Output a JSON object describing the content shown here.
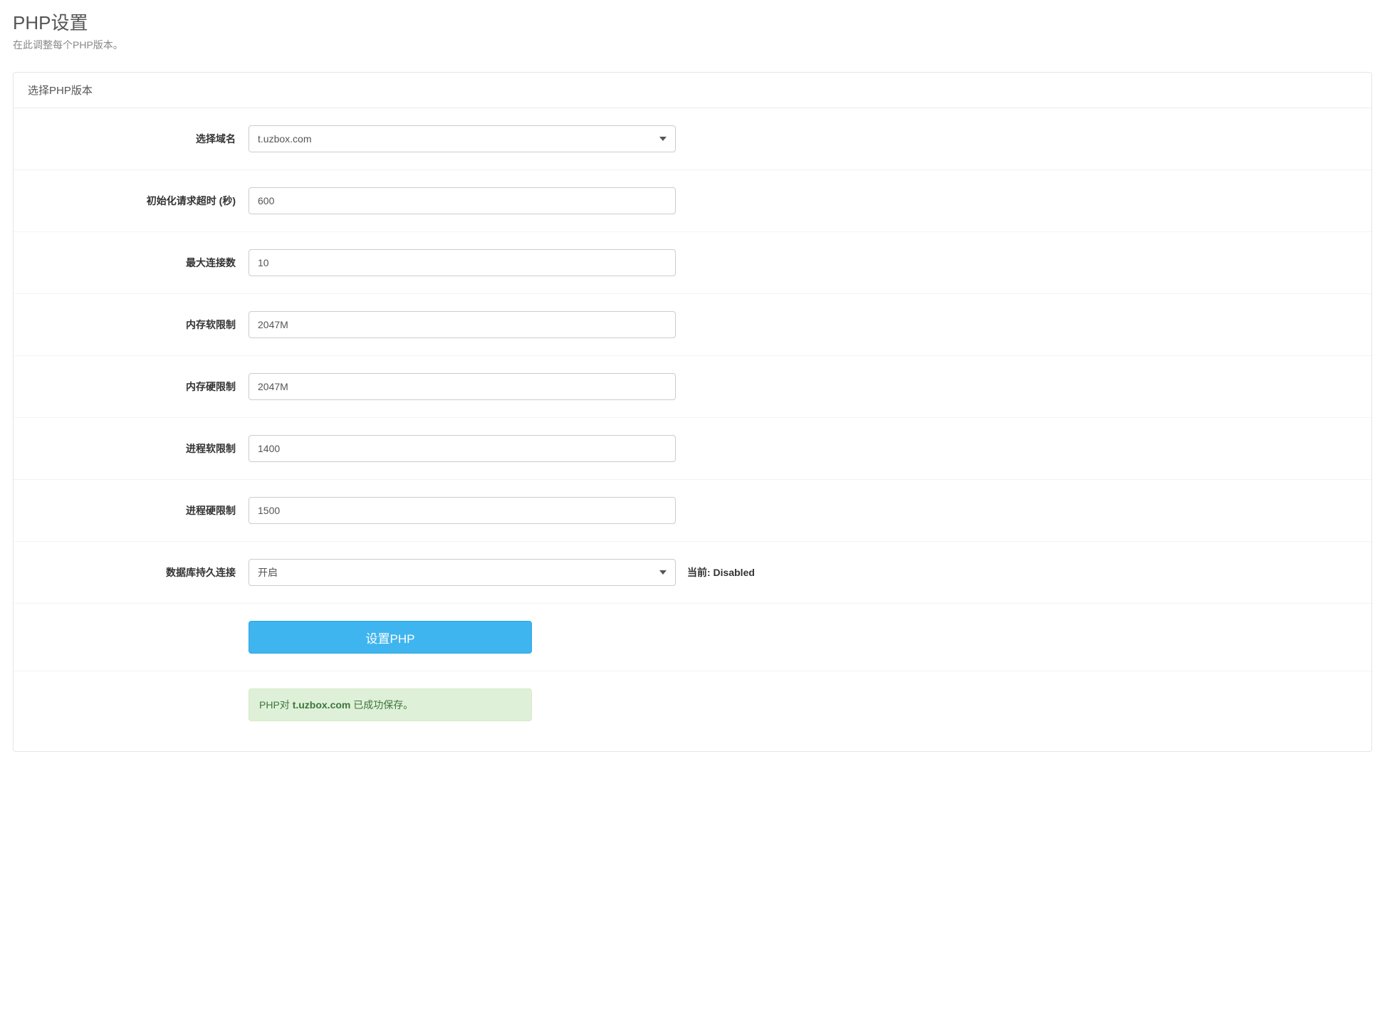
{
  "header": {
    "title": "PHP设置",
    "subtitle": "在此调整每个PHP版本。"
  },
  "panel": {
    "title": "选择PHP版本"
  },
  "form": {
    "domain": {
      "label": "选择域名",
      "value": "t.uzbox.com"
    },
    "init_timeout": {
      "label": "初始化请求超时 (秒)",
      "value": "600"
    },
    "max_connections": {
      "label": "最大连接数",
      "value": "10"
    },
    "mem_soft": {
      "label": "内存软限制",
      "value": "2047M"
    },
    "mem_hard": {
      "label": "内存硬限制",
      "value": "2047M"
    },
    "proc_soft": {
      "label": "进程软限制",
      "value": "1400"
    },
    "proc_hard": {
      "label": "进程硬限制",
      "value": "1500"
    },
    "persistent": {
      "label": "数据库持久连接",
      "value": "开启",
      "help": "当前: Disabled"
    },
    "submit_label": "设置PHP"
  },
  "alert": {
    "prefix": "PHP对 ",
    "domain": "t.uzbox.com",
    "suffix": " 已成功保存。"
  }
}
